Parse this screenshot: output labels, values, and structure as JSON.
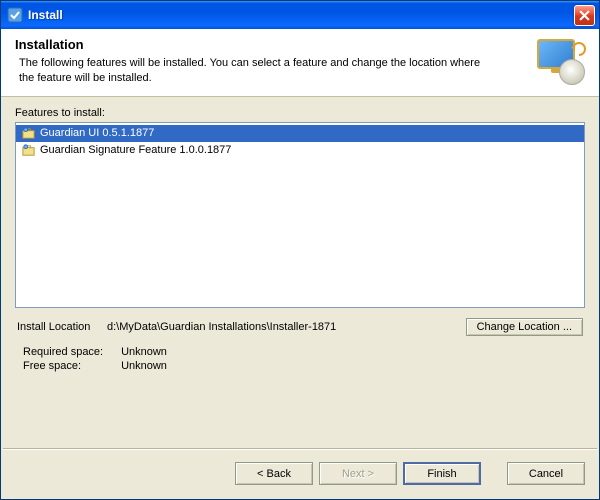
{
  "window": {
    "title": "Install"
  },
  "header": {
    "heading": "Installation",
    "description": "The following features will be installed. You can select a feature and change the location where the feature will be installed."
  },
  "features": {
    "label": "Features to install:",
    "items": [
      {
        "label": "Guardian UI 0.5.1.1877",
        "selected": true
      },
      {
        "label": "Guardian Signature Feature 1.0.0.1877",
        "selected": false
      }
    ]
  },
  "install_location": {
    "label": "Install Location",
    "path": "d:\\MyData\\Guardian Installations\\Installer-1871",
    "change_button": "Change Location ..."
  },
  "space": {
    "required_label": "Required space:",
    "required_value": "Unknown",
    "free_label": "Free space:",
    "free_value": "Unknown"
  },
  "buttons": {
    "back": "< Back",
    "next": "Next >",
    "finish": "Finish",
    "cancel": "Cancel"
  }
}
